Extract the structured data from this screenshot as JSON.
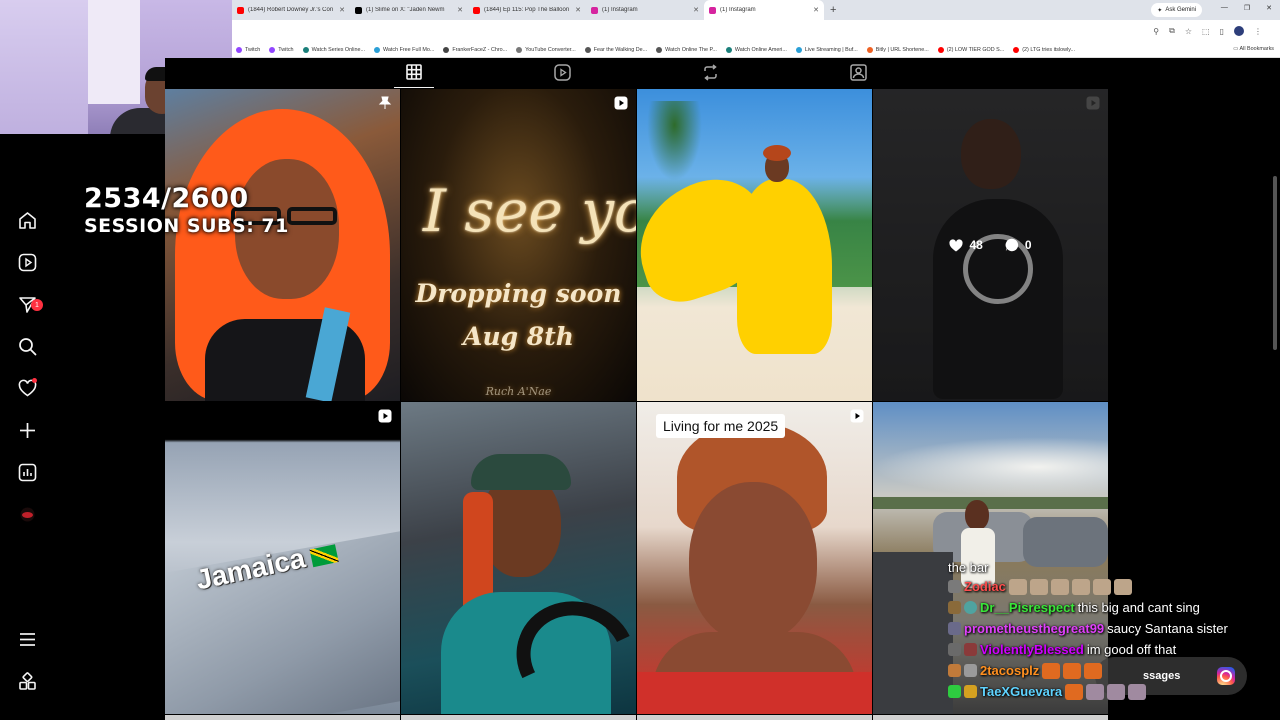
{
  "browser": {
    "tabs": [
      {
        "title": "(1844) Robert Downey Jr.'s Con",
        "color": "#ff0000"
      },
      {
        "title": "(1) Slime on X: \"Jaden Newm",
        "color": "#000000"
      },
      {
        "title": "(1844) Ep 115: Pop The Balloon",
        "color": "#ff0000"
      },
      {
        "title": "(1) Instagram",
        "color": "#d6249f"
      },
      {
        "title": "(1) Instagram",
        "color": "#d6249f",
        "active": true
      }
    ],
    "new_tab": "+",
    "gemini_label": "Ask Gemini",
    "bookmarks": [
      {
        "label": "Twitch",
        "color": "#9146ff"
      },
      {
        "label": "Twitch",
        "color": "#9146ff"
      },
      {
        "label": "Watch Series Online...",
        "color": "#1a7f7a"
      },
      {
        "label": "Watch Free Full Mo...",
        "color": "#2a9fd6"
      },
      {
        "label": "FrankerFaceZ - Chro...",
        "color": "#444444"
      },
      {
        "label": "YouTube Converter...",
        "color": "#777777"
      },
      {
        "label": "Fear the Walking De...",
        "color": "#555555"
      },
      {
        "label": "Watch Online The P...",
        "color": "#555555"
      },
      {
        "label": "Watch Online Ameri...",
        "color": "#1a7f7a"
      },
      {
        "label": "Live Streaming | Buf...",
        "color": "#2a9fd6"
      },
      {
        "label": "Bitly | URL Shortene...",
        "color": "#ee6123"
      },
      {
        "label": "(2) LOW TIER GOD S...",
        "color": "#ff0000"
      },
      {
        "label": "(2) LTG tries itslowly...",
        "color": "#ff0000"
      }
    ],
    "all_bookmarks": "All Bookmarks"
  },
  "overlay": {
    "sub_count": "2534/2600",
    "session_subs": "SESSION SUBS: 71"
  },
  "sidebar": {
    "messages_badge": "1"
  },
  "posts": {
    "p2_script": "I see you",
    "p2_drop": "Dropping soon",
    "p2_date": "Aug 8th",
    "p2_signature": "Ruch A'Nae",
    "p4_likes": "48",
    "p4_comments": "0",
    "p5_caption": "Jamaica",
    "p7_caption": "Living for me 2025"
  },
  "chat": {
    "first_line": "the bar",
    "messages": [
      {
        "user": "Zodiac",
        "color": "#ff4d4d",
        "text": ""
      },
      {
        "user": "Dr__Pisrespect",
        "color": "#39e639",
        "text": "this big and cant sing"
      },
      {
        "user": "prometheusthegreat99",
        "color": "#e040fb",
        "text": "saucy Santana sister"
      },
      {
        "user": "ViolentlyBlessed",
        "color": "#d000ff",
        "text": "im good off that"
      },
      {
        "user": "2tacosplz",
        "color": "#ff9020",
        "text": ""
      },
      {
        "user": "TaeXGuevara",
        "color": "#5fd3ff",
        "text": ""
      }
    ],
    "more_messages": "ssages"
  }
}
